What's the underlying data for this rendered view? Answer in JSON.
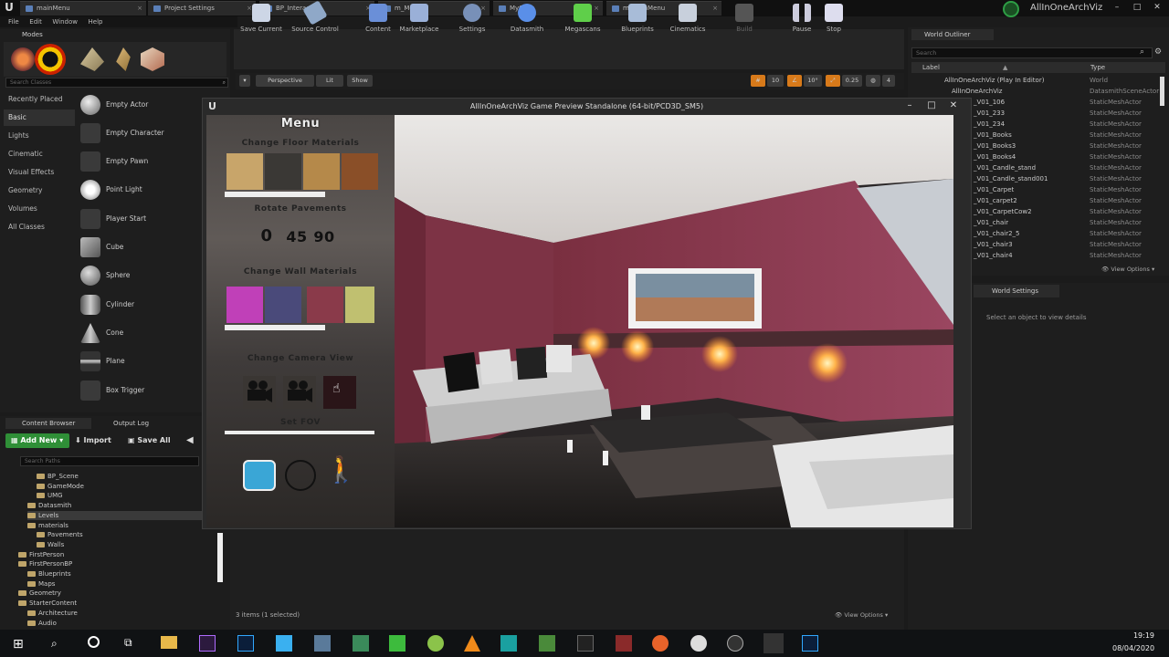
{
  "tabs": [
    {
      "label": "mainMenu"
    },
    {
      "label": "Project Settings"
    },
    {
      "label": "BP_Interactive"
    },
    {
      "label": "m_Menu"
    },
    {
      "label": "MyChar"
    },
    {
      "label": "m_MainMenu"
    }
  ],
  "project_name": "AllInOneArchViz",
  "menubar": [
    "File",
    "Edit",
    "Window",
    "Help"
  ],
  "modes": {
    "tab_label": "Modes",
    "search_placeholder": "Search Classes",
    "categories": [
      "Recently Placed",
      "Basic",
      "Lights",
      "Cinematic",
      "Visual Effects",
      "Geometry",
      "Volumes",
      "All Classes"
    ],
    "actors": [
      "Empty Actor",
      "Empty Character",
      "Empty Pawn",
      "Point Light",
      "Player Start",
      "Cube",
      "Sphere",
      "Cylinder",
      "Cone",
      "Plane",
      "Box Trigger"
    ]
  },
  "toolbar": [
    {
      "label": "Save Current",
      "icon": "save-icon"
    },
    {
      "label": "Source Control",
      "icon": "source-control-icon"
    },
    {
      "label": "Content",
      "icon": "content-icon"
    },
    {
      "label": "Marketplace",
      "icon": "marketplace-icon"
    },
    {
      "label": "Settings",
      "icon": "settings-icon"
    },
    {
      "label": "Datasmith",
      "icon": "datasmith-icon"
    },
    {
      "label": "Megascans",
      "icon": "megascans-icon"
    },
    {
      "label": "Blueprints",
      "icon": "blueprints-icon"
    },
    {
      "label": "Cinematics",
      "icon": "cinematics-icon"
    },
    {
      "label": "Build",
      "icon": "build-icon"
    },
    {
      "label": "Pause",
      "icon": "pause-icon"
    },
    {
      "label": "Stop",
      "icon": "stop-icon"
    }
  ],
  "viewport_bar": {
    "perspective": "Perspective",
    "lit": "Lit",
    "show": "Show",
    "grid_value": "10",
    "angle_value": "10°",
    "scale_value": "0.25",
    "camera_speed": "4"
  },
  "outliner": {
    "tab_label": "World Outliner",
    "search_placeholder": "Search",
    "col_label": "Label",
    "col_type": "Type",
    "rows": [
      {
        "label": "AllInOneArchViz (Play In Editor)",
        "type": "World"
      },
      {
        "label": "AllInOneArchViz",
        "type": "DatasmithSceneActor"
      },
      {
        "label": "_V01_106",
        "type": "StaticMeshActor"
      },
      {
        "label": "_V01_233",
        "type": "StaticMeshActor"
      },
      {
        "label": "_V01_234",
        "type": "StaticMeshActor"
      },
      {
        "label": "_V01_Books",
        "type": "StaticMeshActor"
      },
      {
        "label": "_V01_Books3",
        "type": "StaticMeshActor"
      },
      {
        "label": "_V01_Books4",
        "type": "StaticMeshActor"
      },
      {
        "label": "_V01_Candle_stand",
        "type": "StaticMeshActor"
      },
      {
        "label": "_V01_Candle_stand001",
        "type": "StaticMeshActor"
      },
      {
        "label": "_V01_Carpet",
        "type": "StaticMeshActor"
      },
      {
        "label": "_V01_carpet2",
        "type": "StaticMeshActor"
      },
      {
        "label": "_V01_CarpetCow2",
        "type": "StaticMeshActor"
      },
      {
        "label": "_V01_chair",
        "type": "StaticMeshActor"
      },
      {
        "label": "_V01_chair2_5",
        "type": "StaticMeshActor"
      },
      {
        "label": "_V01_chair3",
        "type": "StaticMeshActor"
      },
      {
        "label": "_V01_chair4",
        "type": "StaticMeshActor"
      }
    ],
    "view_options": "View Options"
  },
  "details": {
    "tab_label": "World Settings",
    "empty_message": "Select an object to view details"
  },
  "content_browser": {
    "tab_label": "Content Browser",
    "output_tab": "Output Log",
    "add_new": "Add New",
    "import": "Import",
    "save_all": "Save All",
    "search_placeholder": "Search Paths",
    "tree": [
      {
        "label": "BP_Scene",
        "indent": 3
      },
      {
        "label": "GameMode",
        "indent": 3
      },
      {
        "label": "UMG",
        "indent": 3
      },
      {
        "label": "Datasmith",
        "indent": 2
      },
      {
        "label": "Levels",
        "indent": 2,
        "selected": true
      },
      {
        "label": "materials",
        "indent": 2
      },
      {
        "label": "Pavements",
        "indent": 3
      },
      {
        "label": "Walls",
        "indent": 3
      },
      {
        "label": "FirstPerson",
        "indent": 1
      },
      {
        "label": "FirstPersonBP",
        "indent": 1
      },
      {
        "label": "Blueprints",
        "indent": 2
      },
      {
        "label": "Maps",
        "indent": 2
      },
      {
        "label": "Geometry",
        "indent": 1
      },
      {
        "label": "StarterContent",
        "indent": 1
      },
      {
        "label": "Architecture",
        "indent": 2
      },
      {
        "label": "Audio",
        "indent": 2
      }
    ],
    "items_count": "3 items (1 selected)",
    "view_options": "View Options"
  },
  "game_window": {
    "title": "AllInOneArchViz Game Preview Standalone (64-bit/PCD3D_SM5)",
    "menu_title": "Menu",
    "floor_heading": "Change Floor Materials",
    "rotate_heading": "Rotate Pavements",
    "rotate_values": [
      "0",
      "45",
      "90"
    ],
    "wall_heading": "Change Wall Materials",
    "camera_heading": "Change Camera View",
    "fov_heading": "Set FOV",
    "floor_colors": [
      "#c8a56a",
      "#3a3835",
      "#b5894a",
      "#8a4f28"
    ],
    "wall_colors": [
      "#c040b8",
      "#4a4a7a",
      "#8a3a4a",
      "#c0c070"
    ]
  },
  "taskbar": {
    "time": "19:19",
    "date": "08/04/2020"
  }
}
